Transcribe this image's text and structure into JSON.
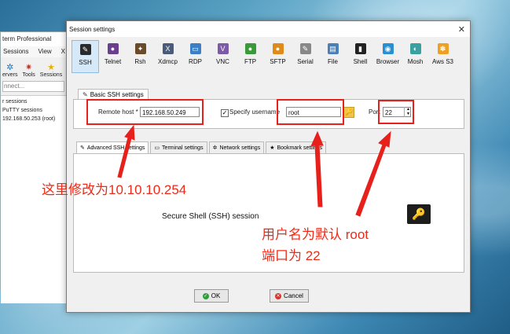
{
  "bg_window": {
    "title_fragment": "term Professional",
    "menu": [
      "Sessions",
      "View",
      "X"
    ],
    "toolbar": [
      "ervers",
      "Tools",
      "Sessions"
    ],
    "quick_connect": "nnect...",
    "sessions": [
      "r sessions",
      "PuTTY sessions",
      "192.168.50.253 (root)"
    ]
  },
  "dialog": {
    "title": "Session settings",
    "close_glyph": "✕",
    "protocols": [
      {
        "label": "SSH",
        "color": "#2a2a2a",
        "glyph": "✎"
      },
      {
        "label": "Telnet",
        "color": "#6a3e8e",
        "glyph": "●"
      },
      {
        "label": "Rsh",
        "color": "#6b4a2a",
        "glyph": "✦"
      },
      {
        "label": "Xdmcp",
        "color": "#4a5a78",
        "glyph": "X"
      },
      {
        "label": "RDP",
        "color": "#3c7fc4",
        "glyph": "▭"
      },
      {
        "label": "VNC",
        "color": "#7c5aa8",
        "glyph": "V"
      },
      {
        "label": "FTP",
        "color": "#3a9a3a",
        "glyph": "●"
      },
      {
        "label": "SFTP",
        "color": "#e08a1a",
        "glyph": "●"
      },
      {
        "label": "Serial",
        "color": "#888888",
        "glyph": "✎"
      },
      {
        "label": "File",
        "color": "#4a7fb8",
        "glyph": "▤"
      },
      {
        "label": "Shell",
        "color": "#222222",
        "glyph": "▮"
      },
      {
        "label": "Browser",
        "color": "#2a8fd0",
        "glyph": "◉"
      },
      {
        "label": "Mosh",
        "color": "#3aa0a0",
        "glyph": "◐"
      },
      {
        "label": "Aws S3",
        "color": "#f0a020",
        "glyph": "✽"
      }
    ],
    "basic_tab": "Basic SSH settings",
    "remote_host_label": "Remote host *",
    "remote_host_value": "192.168.50.249",
    "specify_username_label": "Specify username",
    "specify_username_checked": "✓",
    "username_value": "root",
    "port_label": "Port",
    "port_value": "22",
    "adv_tabs": [
      {
        "label": "Advanced SSH settings",
        "glyph": "✎"
      },
      {
        "label": "Terminal settings",
        "glyph": "▭"
      },
      {
        "label": "Network settings",
        "glyph": "✲"
      },
      {
        "label": "Bookmark settings",
        "glyph": "★"
      }
    ],
    "session_label": "Secure Shell (SSH) session",
    "ok_label": "OK",
    "cancel_label": "Cancel"
  },
  "annotations": {
    "host_note": "这里修改为10.10.10.254",
    "user_note_1": "用户名为默认 root",
    "user_note_2": "端口为 22"
  },
  "colors": {
    "annotation_red": "#e8201c",
    "accent_blue": "#3c7fc4"
  }
}
